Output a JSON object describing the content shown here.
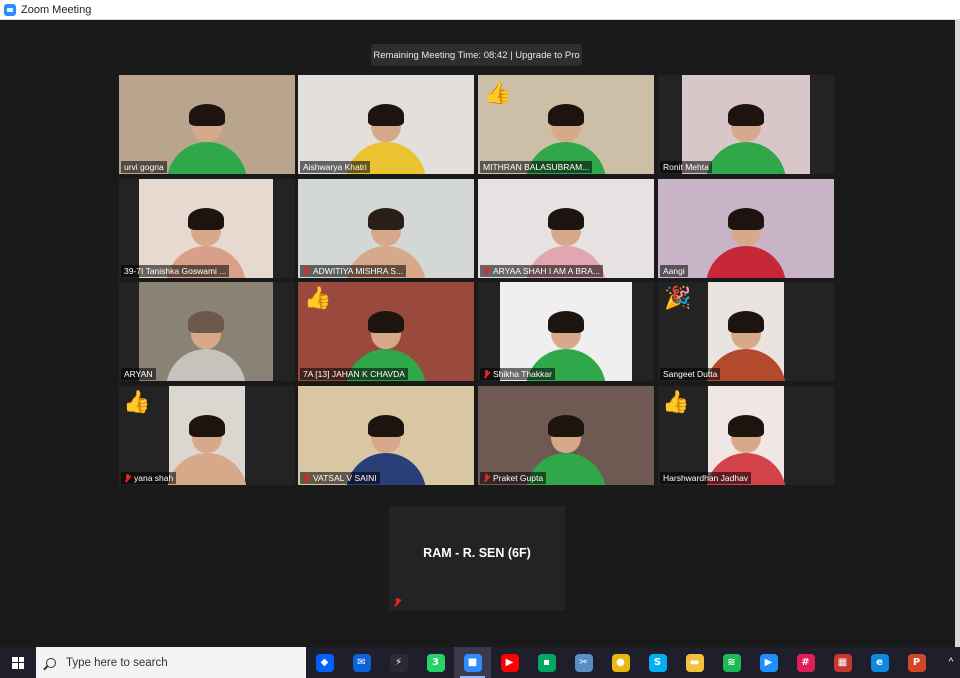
{
  "window": {
    "title": "Zoom Meeting",
    "app_icon": "zoom-camera-icon"
  },
  "banner": {
    "text": "Remaining Meeting Time: 08:42 | Upgrade to Pro"
  },
  "participants": [
    {
      "name": "urvi gogna",
      "muted": false,
      "wall": "#b9a48d",
      "shirt": "#2fa84a",
      "hair": "#1d1410",
      "emoji": ""
    },
    {
      "name": "Aishwarya Khatri",
      "muted": false,
      "wall": "#e3e0dc",
      "shirt": "#e9c430",
      "hair": "#1d1410",
      "emoji": "",
      "active": true
    },
    {
      "name": "MITHRAN BALASUBRAM...",
      "muted": false,
      "wall": "#cdbfa7",
      "shirt": "#2fa84a",
      "hair": "#1d1410",
      "emoji": "👍"
    },
    {
      "name": "Ronit Mehta",
      "muted": false,
      "wall": "#d8c6c8",
      "shirt": "#2fa84a",
      "hair": "#1d1410",
      "emoji": ""
    },
    {
      "name": "39-7I Tanishka Goswami ...",
      "muted": false,
      "wall": "#e6d9cf",
      "shirt": "#d9a089",
      "hair": "#1d1410",
      "emoji": ""
    },
    {
      "name": "ADWITIYA MISHRA    S...",
      "muted": true,
      "wall": "#d3d7d8",
      "shirt": "#d7a98a",
      "hair": "#2a1f18",
      "emoji": ""
    },
    {
      "name": "ARYAA SHAH I AM A BRA...",
      "muted": true,
      "wall": "#e6e2e2",
      "shirt": "#e2a6b0",
      "hair": "#1d1410",
      "emoji": ""
    },
    {
      "name": "Aangi",
      "muted": false,
      "wall": "#c9b3c7",
      "shirt": "#c6283a",
      "hair": "#1d1410",
      "emoji": ""
    },
    {
      "name": "ARYAN",
      "muted": false,
      "wall": "#8a8275",
      "shirt": "#c7c2bc",
      "hair": "#6b5a4b",
      "emoji": ""
    },
    {
      "name": "7A [13] JAHAN K CHAVDA",
      "muted": false,
      "wall": "#9a4a3c",
      "shirt": "#2fa84a",
      "hair": "#1d1410",
      "emoji": "👍"
    },
    {
      "name": "Shikha Thakkar",
      "muted": true,
      "wall": "#efefef",
      "shirt": "#2fa84a",
      "hair": "#1d1410",
      "emoji": ""
    },
    {
      "name": "Sangeet Dutta",
      "muted": false,
      "wall": "#e9e4df",
      "shirt": "#b24a2e",
      "hair": "#1d1410",
      "emoji": "🎉"
    },
    {
      "name": "yana shah",
      "muted": true,
      "wall": "#dcd6d0",
      "shirt": "#d7a98a",
      "hair": "#1d1410",
      "emoji": "👍"
    },
    {
      "name": "VATSAL V SAINI",
      "muted": true,
      "wall": "#d8c7a2",
      "shirt": "#2a3f78",
      "hair": "#1d1410",
      "emoji": ""
    },
    {
      "name": "Praket Gupta",
      "muted": true,
      "wall": "#6e5a52",
      "shirt": "#2fa84a",
      "hair": "#1d1410",
      "emoji": ""
    },
    {
      "name": "Harshwardhan Jadhav",
      "muted": false,
      "wall": "#f0e6e6",
      "shirt": "#d4424a",
      "hair": "#1d1410",
      "emoji": "👍"
    }
  ],
  "audio_only": {
    "name": "RAM - R. SEN (6F)",
    "muted": true
  },
  "taskbar": {
    "search_placeholder": "Type here to search",
    "apps": [
      {
        "name": "dropbox-icon",
        "color": "#0061fe",
        "glyph": "◆"
      },
      {
        "name": "mail-icon",
        "color": "#0a64d8",
        "glyph": "✉"
      },
      {
        "name": "bolt-app-icon",
        "color": "#2a2a35",
        "glyph": "⚡"
      },
      {
        "name": "whatsapp-icon",
        "color": "#25d366",
        "glyph": "3"
      },
      {
        "name": "zoom-icon",
        "color": "#2d8cff",
        "glyph": "■",
        "active": true
      },
      {
        "name": "youtube-icon",
        "color": "#ff0000",
        "glyph": "▶"
      },
      {
        "name": "meet-icon",
        "color": "#00a862",
        "glyph": "▪"
      },
      {
        "name": "snipping-tool-icon",
        "color": "#5a8fc4",
        "glyph": "✂"
      },
      {
        "name": "chrome-icon",
        "color": "#e8b710",
        "glyph": "●"
      },
      {
        "name": "skype-icon",
        "color": "#00aff0",
        "glyph": "S"
      },
      {
        "name": "file-explorer-icon",
        "color": "#f3c13a",
        "glyph": "▬"
      },
      {
        "name": "spotify-icon",
        "color": "#1db954",
        "glyph": "≋"
      },
      {
        "name": "media-player-icon",
        "color": "#1e90ff",
        "glyph": "▶"
      },
      {
        "name": "slack-icon",
        "color": "#e01e5a",
        "glyph": "#"
      },
      {
        "name": "calendar-app-icon",
        "color": "#c8372d",
        "glyph": "▦"
      },
      {
        "name": "edge-icon",
        "color": "#0c8adf",
        "glyph": "e"
      },
      {
        "name": "powerpoint-icon",
        "color": "#d24726",
        "glyph": "P"
      }
    ],
    "tray_chevron": "^"
  }
}
